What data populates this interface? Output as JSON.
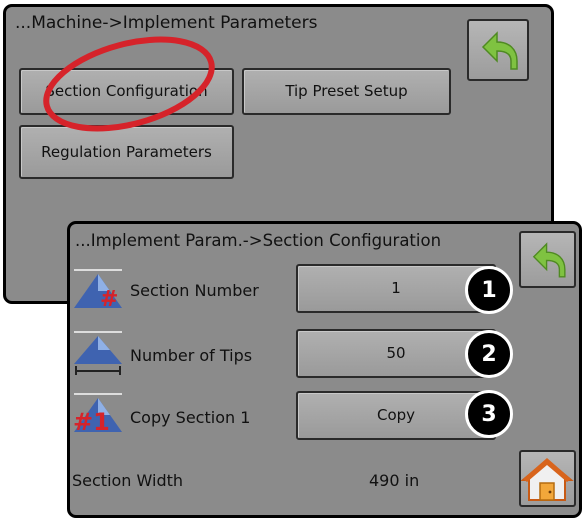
{
  "back_panel": {
    "title": "...Machine->Implement Parameters",
    "buttons": {
      "section_configuration": "Section Configuration",
      "tip_preset_setup": "Tip Preset Setup",
      "regulation_parameters": "Regulation Parameters"
    }
  },
  "front_panel": {
    "title": "...Implement Param.->Section Configuration",
    "rows": [
      {
        "label": "Section Number",
        "value": "1",
        "callout": "1"
      },
      {
        "label": "Number of Tips",
        "value": "50",
        "callout": "2"
      },
      {
        "label": "Copy Section 1",
        "value": "Copy",
        "callout": "3"
      }
    ],
    "section_width": {
      "label": "Section Width",
      "value": "490 in"
    }
  },
  "icons": [
    "back-arrow-icon",
    "home-icon",
    "section-number-icon",
    "number-of-tips-icon",
    "copy-section-icon"
  ],
  "colors": {
    "panel": "#8b8b8b",
    "highlight_ellipse": "#d6232a",
    "back_arrow": "#7fc241"
  }
}
